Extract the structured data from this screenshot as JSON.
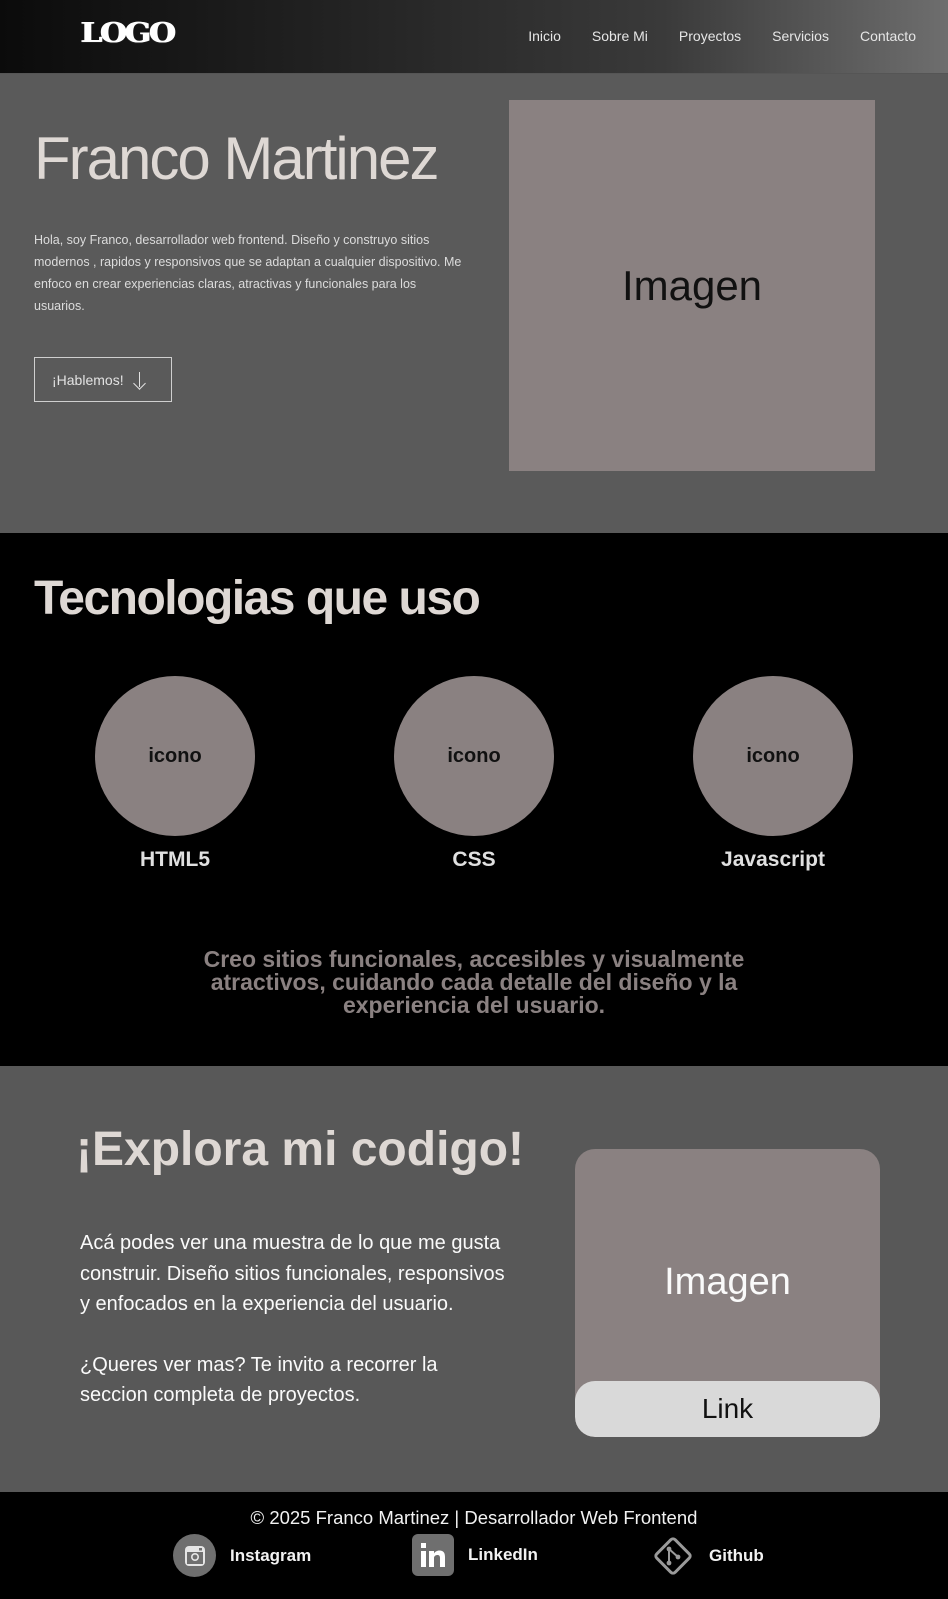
{
  "nav": {
    "logo": "LOGO",
    "links": [
      "Inicio",
      "Sobre Mi",
      "Proyectos",
      "Servicios",
      "Contacto"
    ]
  },
  "hero": {
    "title": "Franco Martinez",
    "text": "Hola, soy Franco, desarrollador web frontend. Diseño y construyo sitios modernos , rapidos y responsivos que se adaptan a cualquier dispositivo. Me enfoco en crear experiencias claras, atractivas y funcionales para los usuarios.",
    "button": "¡Hablemos!",
    "image_placeholder": "Imagen"
  },
  "tech": {
    "title": "Tecnologias que uso",
    "items": [
      {
        "icon": "icono",
        "label": "HTML5"
      },
      {
        "icon": "icono",
        "label": "CSS"
      },
      {
        "icon": "icono",
        "label": "Javascript"
      }
    ],
    "quote": "Creo sitios funcionales, accesibles y visualmente atractivos, cuidando cada detalle del diseño y la experiencia del usuario."
  },
  "explore": {
    "title": "¡Explora mi codigo!",
    "paragraph1": "Acá podes ver una muestra de lo que me gusta construir. Diseño sitios funcionales, responsivos y enfocados en la experiencia del usuario.",
    "paragraph2": "¿Queres ver mas? Te invito a recorrer la seccion completa de proyectos.",
    "card_image": "Imagen",
    "card_link": "Link"
  },
  "footer": {
    "copyright": "© 2025 Franco Martinez | Desarrollador Web Frontend",
    "social": [
      {
        "icon": "instagram-icon",
        "label": "Instagram"
      },
      {
        "icon": "linkedin-icon",
        "label": "LinkedIn"
      },
      {
        "icon": "git-icon",
        "label": "Github"
      }
    ]
  },
  "colors": {
    "placeholder": "#8a8181",
    "hero_bg": "#5a5a5a",
    "tech_bg": "#000000",
    "heading": "#ded8d4"
  }
}
